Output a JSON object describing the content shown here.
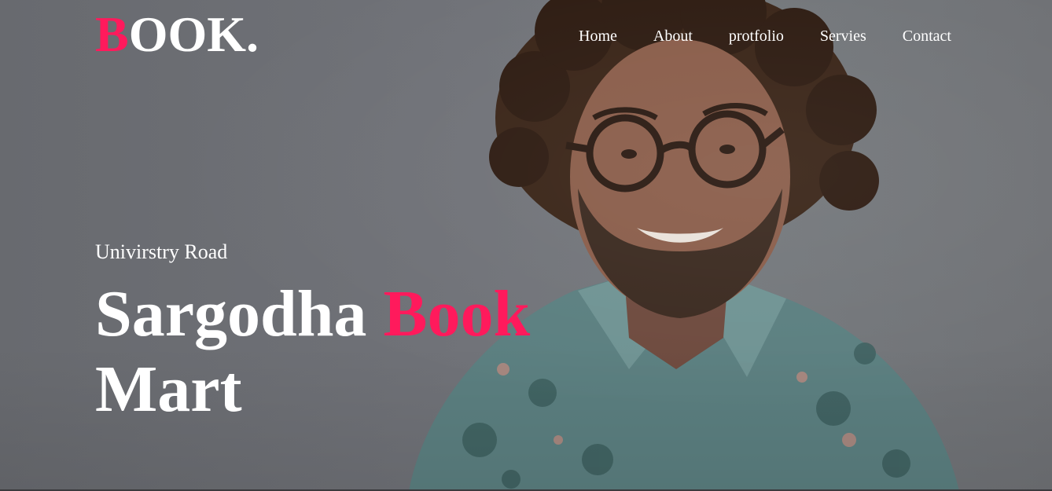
{
  "brand": {
    "logo_first": "B",
    "logo_rest": "OOK.",
    "accent_color": "#ff1a5c"
  },
  "nav": {
    "items": [
      {
        "label": "Home"
      },
      {
        "label": "About"
      },
      {
        "label": "protfolio"
      },
      {
        "label": "Servies"
      },
      {
        "label": "Contact"
      }
    ]
  },
  "hero": {
    "subtitle": "Univirstry Road",
    "headline_part1": "Sargodha",
    "headline_accent": "Book",
    "headline_part2": "Mart",
    "image": "smiling-man-portrait"
  }
}
